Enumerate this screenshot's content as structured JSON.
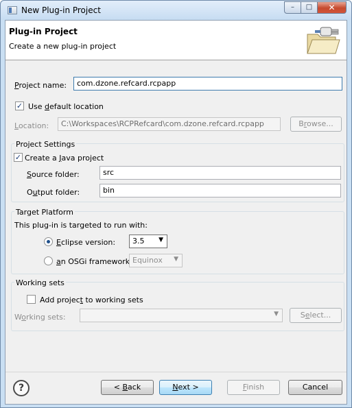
{
  "window": {
    "title": "New Plug-in Project",
    "controls": {
      "minimize": "–",
      "maximize": "□",
      "close": "✕"
    }
  },
  "banner": {
    "title": "Plug-in Project",
    "description": "Create a new plug-in project",
    "icon": "folder-plugin-icon"
  },
  "project": {
    "name_label_mnemonic": "P",
    "name_label_rest": "roject name:",
    "name_value": "com.dzone.refcard.rcpapp",
    "use_default_pre": "Use ",
    "use_default_mnemonic": "d",
    "use_default_post": "efault location",
    "use_default_checked": true,
    "location_label_mnemonic": "L",
    "location_label_rest": "ocation:",
    "location_value": "C:\\Workspaces\\RCPRefcard\\com.dzone.refcard.rcpapp",
    "browse_pre": "B",
    "browse_mnemonic": "r",
    "browse_post": "owse..."
  },
  "project_settings": {
    "title": "Project Settings",
    "create_java_pre": "Create a ",
    "create_java_mnemonic": "J",
    "create_java_post": "ava project",
    "create_java_checked": true,
    "source_label_mnemonic": "S",
    "source_label_rest": "ource folder:",
    "source_value": "src",
    "output_label_pre": "O",
    "output_label_mnemonic": "u",
    "output_label_post": "tput folder:",
    "output_value": "bin"
  },
  "target_platform": {
    "title": "Target Platform",
    "description": "This plug-in is targeted to run with:",
    "eclipse_mnemonic": "E",
    "eclipse_rest": "clipse version:",
    "eclipse_selected": true,
    "eclipse_version": "3.5",
    "osgi_mnemonic": "a",
    "osgi_rest": "n OSGi framework:",
    "osgi_selected": false,
    "osgi_value": "Equinox"
  },
  "working_sets": {
    "title": "Working sets",
    "add_pre": "Add projec",
    "add_mnemonic": "t",
    "add_post": " to working sets",
    "add_checked": false,
    "label_pre": "W",
    "label_mnemonic": "o",
    "label_post": "rking sets:",
    "value": "",
    "select_pre": "S",
    "select_mnemonic": "e",
    "select_post": "lect..."
  },
  "footer": {
    "help": "?",
    "back_pre": "< ",
    "back_mnemonic": "B",
    "back_post": "ack",
    "next_mnemonic": "N",
    "next_post": "ext >",
    "finish_mnemonic": "F",
    "finish_post": "inish",
    "cancel": "Cancel"
  }
}
